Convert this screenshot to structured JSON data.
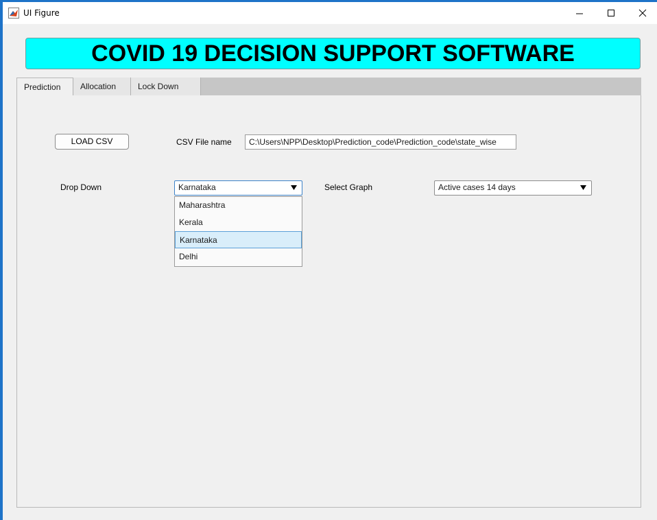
{
  "window": {
    "title": "UI Figure",
    "accent_color": "#1e73c8",
    "controls": {
      "minimize_icon": "minimize-icon",
      "maximize_icon": "maximize-icon",
      "close_icon": "close-icon"
    }
  },
  "header": {
    "title": "COVID 19 DECISION SUPPORT SOFTWARE",
    "background_color": "#00ffff"
  },
  "tabs": [
    {
      "label": "Prediction",
      "active": true
    },
    {
      "label": "Allocation",
      "active": false
    },
    {
      "label": "Lock Down",
      "active": false
    }
  ],
  "prediction": {
    "load_button": "LOAD CSV",
    "csv_label": "CSV File name",
    "csv_path": "C:\\Users\\NPP\\Desktop\\Prediction_code\\Prediction_code\\state_wise",
    "dropdown_label": "Drop Down",
    "state_dropdown": {
      "selected": "Karnataka",
      "expanded": true,
      "options": [
        "Maharashtra",
        "Kerala",
        "Karnataka",
        "Delhi"
      ]
    },
    "graph_label": "Select Graph",
    "graph_dropdown": {
      "selected": "Active cases 14 days"
    }
  }
}
